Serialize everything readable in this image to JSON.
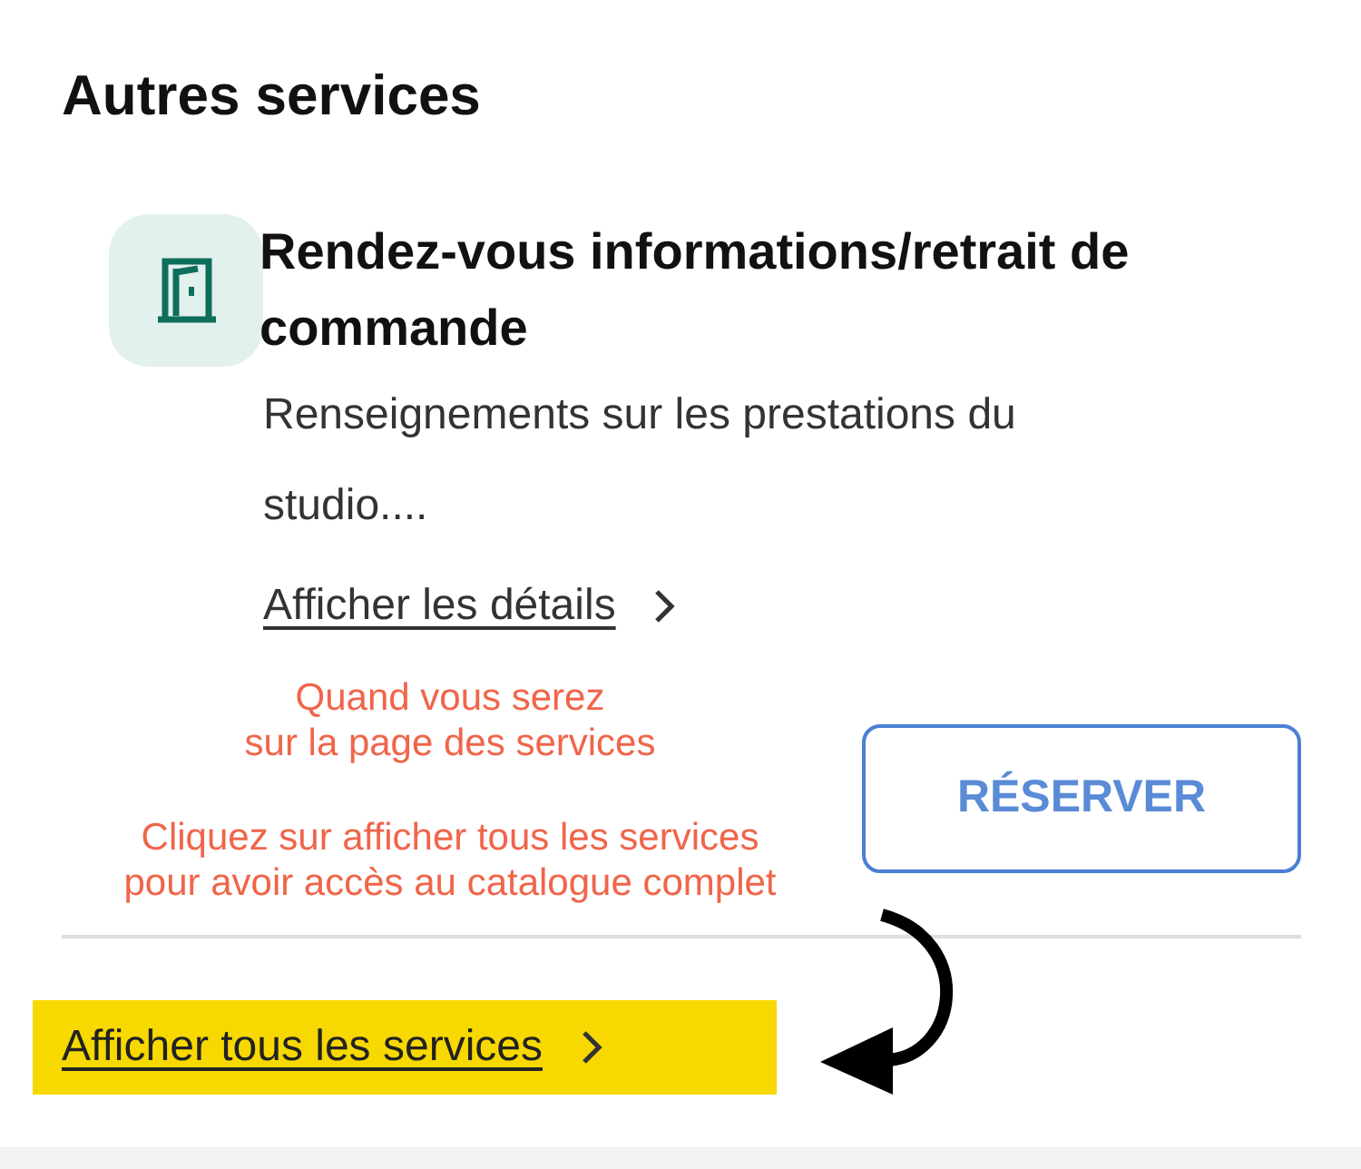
{
  "section_title": "Autres services",
  "service": {
    "title": "Rendez-vous informations/retrait de commande",
    "description": "Renseignements sur les prestations du studio....",
    "details_link": "Afficher les détails",
    "book_button": "RÉSERVER"
  },
  "all_services_link": {
    "label": "Afficher tous les services",
    "highlighted": true
  },
  "annotations": [
    {
      "text": "Quand vous serez\nsur la page des services"
    },
    {
      "text": "Cliquez sur afficher tous les services\npour avoir accès au catalogue complet"
    }
  ]
}
